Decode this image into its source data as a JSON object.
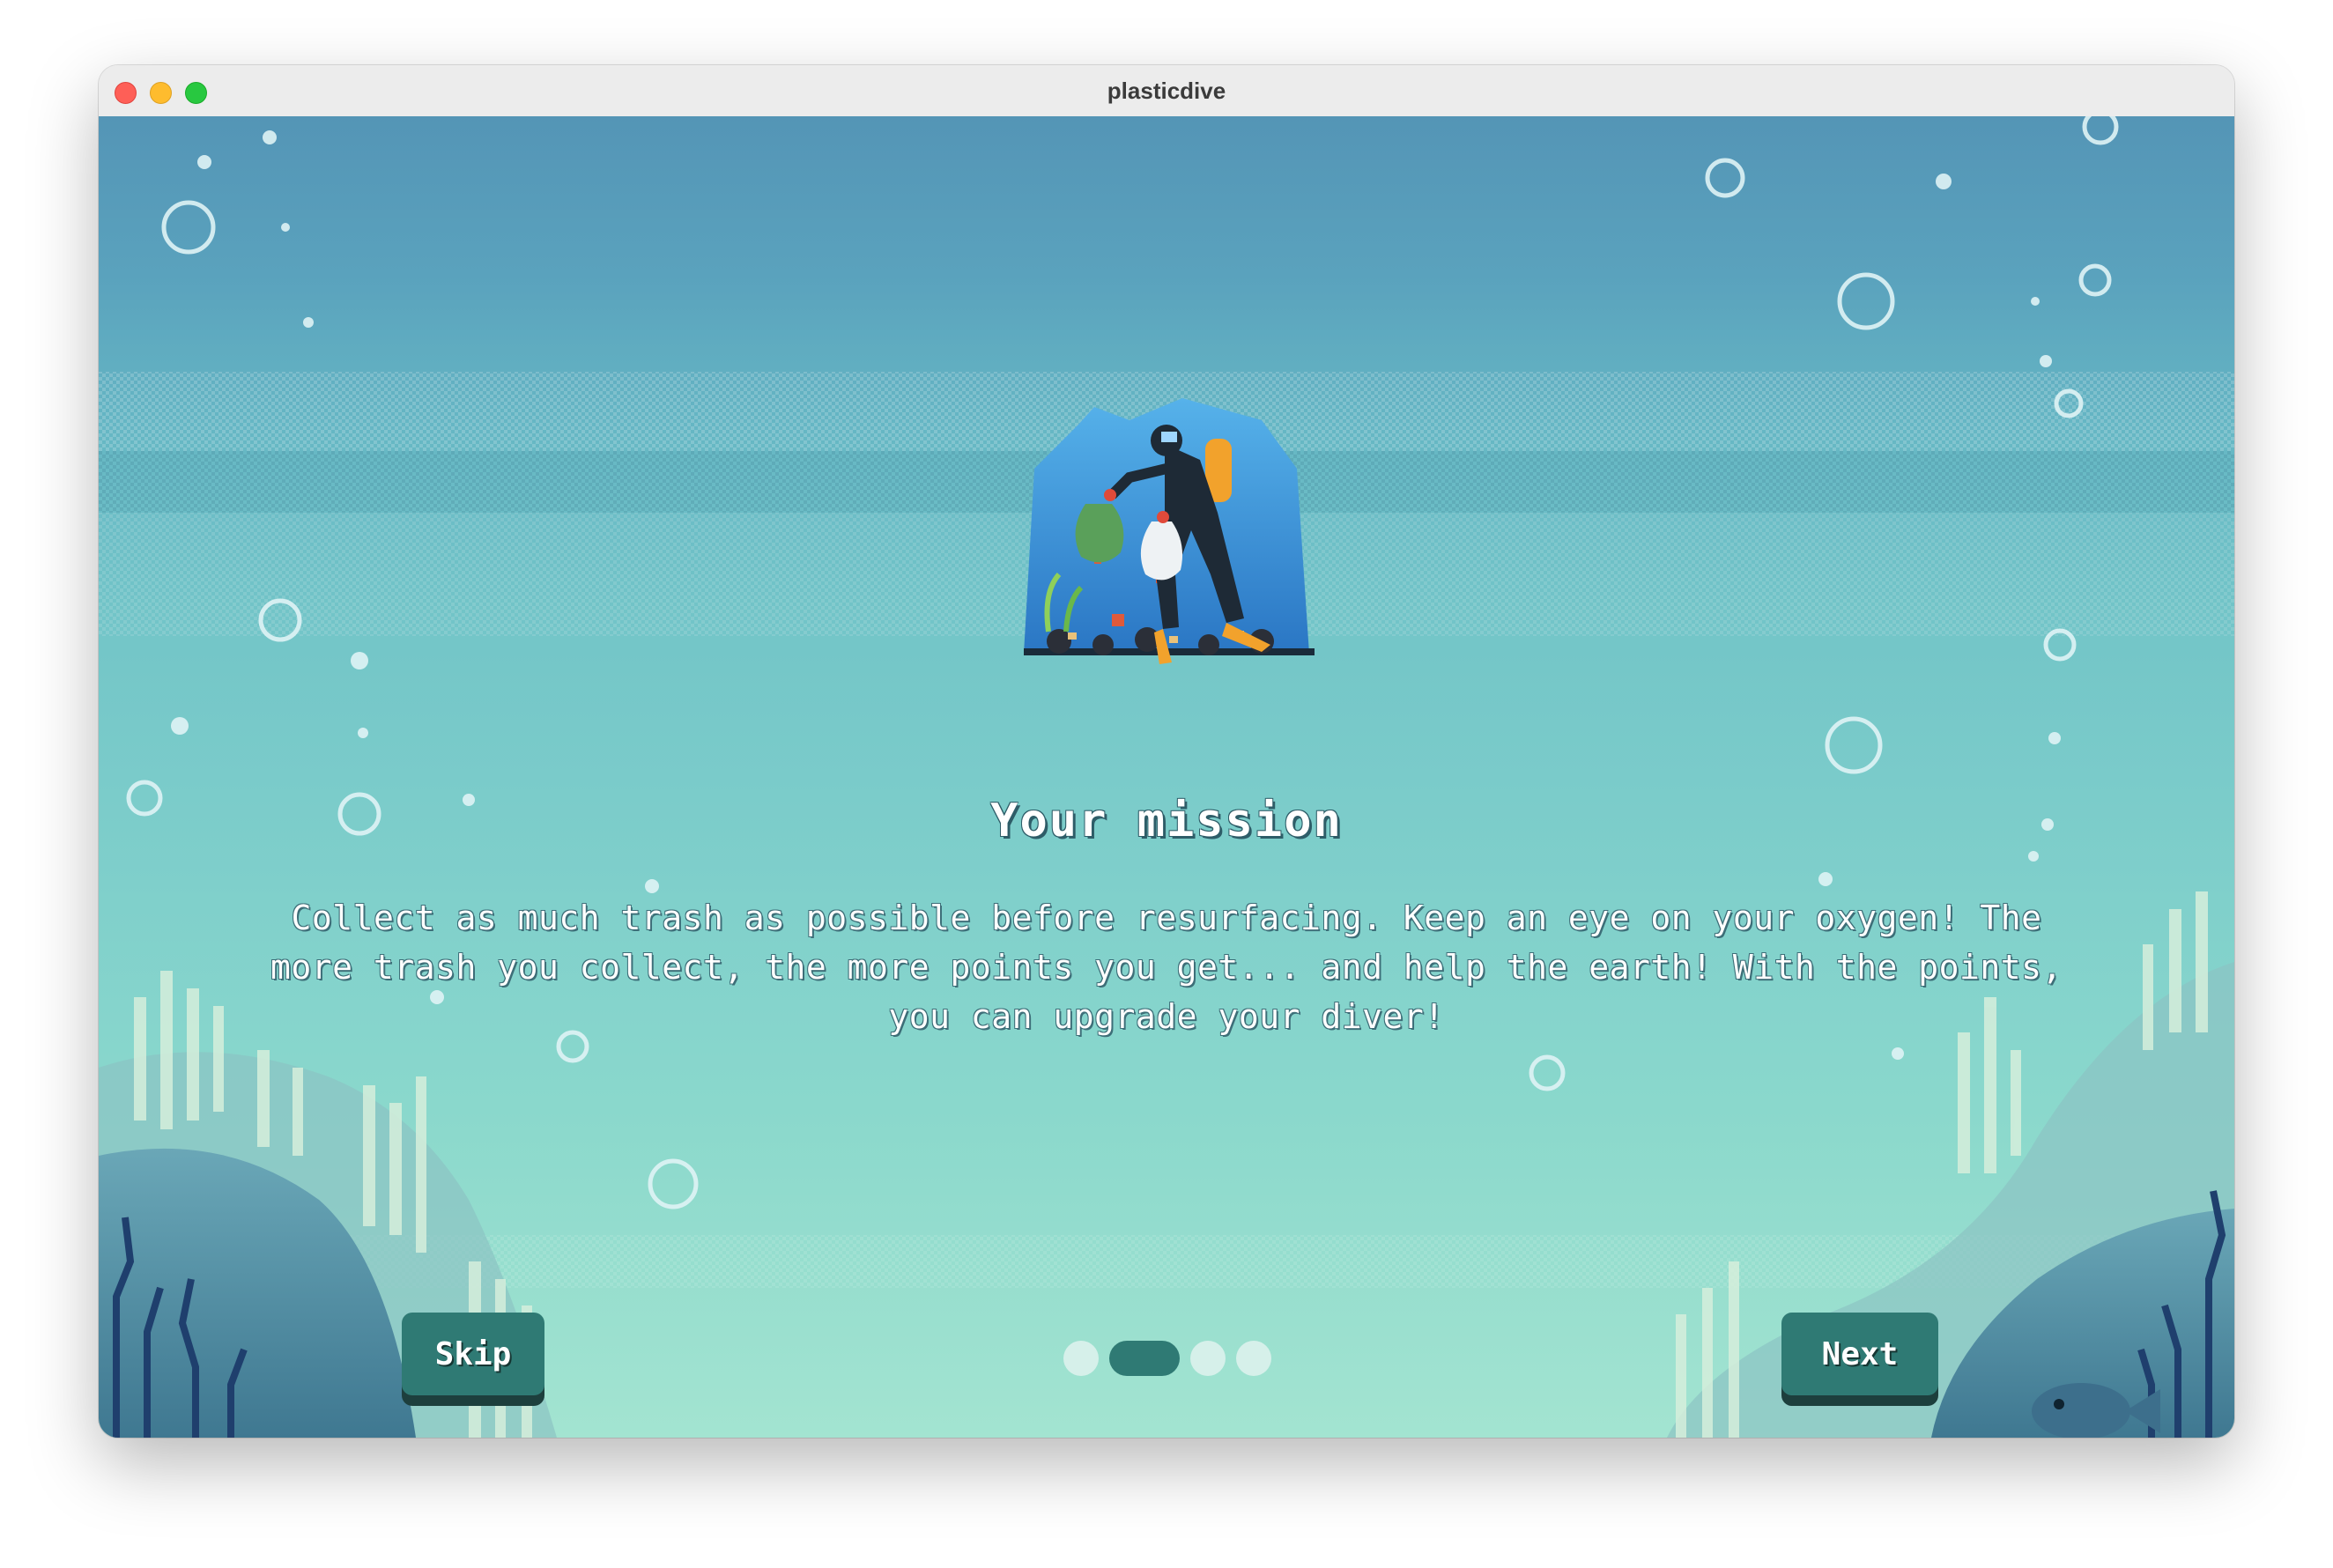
{
  "window": {
    "title": "plasticdive"
  },
  "slide": {
    "heading": "Your mission",
    "body": "Collect as much trash as possible before resurfacing. Keep an eye on your oxygen! The more trash you collect, the more points you get... and help the earth! With the points, you can upgrade your diver!"
  },
  "buttons": {
    "skip_label": "Skip",
    "next_label": "Next"
  },
  "pagination": {
    "total": 4,
    "current": 2
  },
  "colors": {
    "button": "#2f7a74",
    "button_shadow": "#1d3f3d",
    "dot_inactive": "#d6f0ea",
    "dot_active": "#2f7a74",
    "water_top": "#5495b6",
    "water_bottom": "#a3e4d1"
  },
  "icons": {
    "illustration": "scuba-diver-collecting-trash-illustration"
  }
}
